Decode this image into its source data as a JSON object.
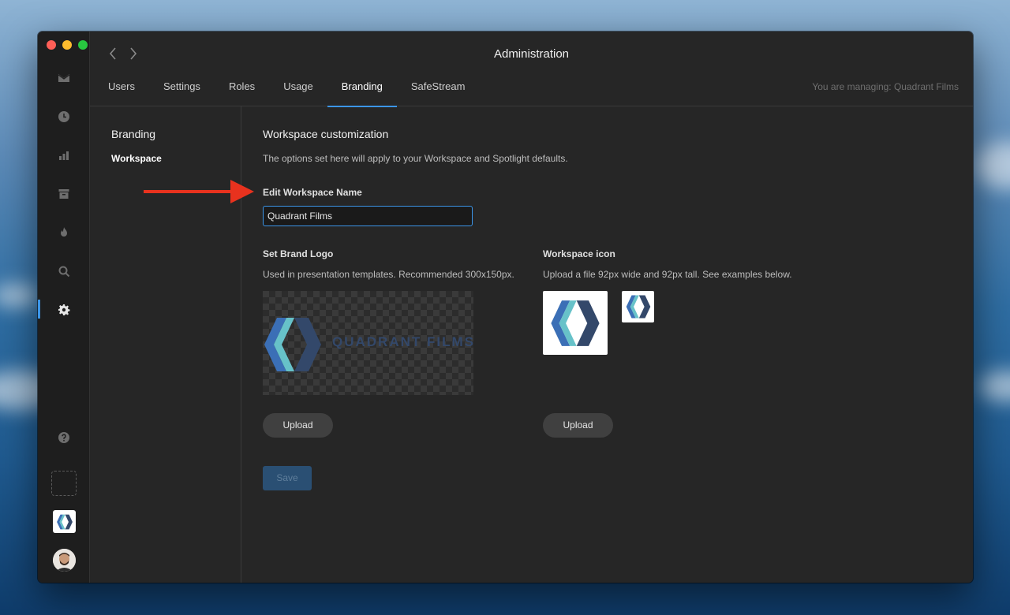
{
  "window": {
    "title": "Administration",
    "managing_text": "You are managing: Quadrant Films"
  },
  "tabs": [
    {
      "label": "Users"
    },
    {
      "label": "Settings"
    },
    {
      "label": "Roles"
    },
    {
      "label": "Usage"
    },
    {
      "label": "Branding",
      "active": true
    },
    {
      "label": "SafeStream"
    }
  ],
  "subnav": {
    "heading": "Branding",
    "items": [
      {
        "label": "Workspace",
        "active": true
      }
    ]
  },
  "content": {
    "title": "Workspace customization",
    "description": "The options set here will apply to your Workspace and Spotlight defaults.",
    "name_label": "Edit Workspace Name",
    "name_value": "Quadrant Films",
    "brand_logo": {
      "label": "Set Brand Logo",
      "help": "Used in presentation templates. Recommended 300x150px.",
      "wordmark": "QUADRANT FILMS",
      "upload_label": "Upload"
    },
    "workspace_icon": {
      "label": "Workspace icon",
      "help": "Upload a file 92px wide and 92px tall. See examples below.",
      "upload_label": "Upload"
    },
    "save_label": "Save"
  },
  "rail_icons": [
    "inbox-icon",
    "clock-icon",
    "bar-chart-icon",
    "archive-icon",
    "flame-icon",
    "search-icon",
    "gear-icon",
    "help-icon"
  ],
  "colors": {
    "accent": "#3b95e8",
    "annotation": "#e8321e",
    "brand_dark": "#33486a",
    "brand_mid": "#3b6fb6",
    "brand_light": "#67c2c9"
  }
}
